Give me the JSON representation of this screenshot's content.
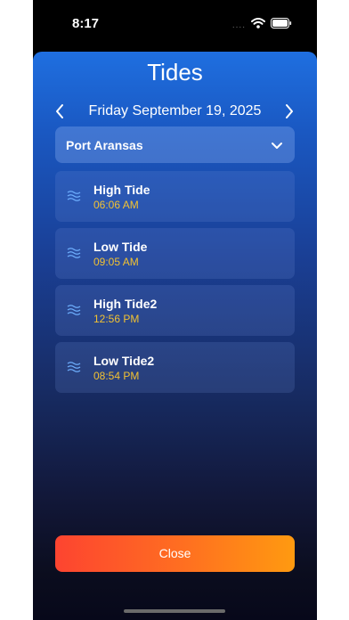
{
  "status_bar": {
    "time": "8:17",
    "dots": "...."
  },
  "header": {
    "title": "Tides"
  },
  "date_nav": {
    "date": "Friday September 19, 2025"
  },
  "location": {
    "selected": "Port Aransas"
  },
  "tides": [
    {
      "name": "High Tide",
      "time": "06:06 AM"
    },
    {
      "name": "Low Tide",
      "time": "09:05 AM"
    },
    {
      "name": "High Tide2",
      "time": "12:56 PM"
    },
    {
      "name": "Low Tide2",
      "time": "08:54 PM"
    }
  ],
  "actions": {
    "close_label": "Close"
  },
  "colors": {
    "accent_time": "#f2c232",
    "button_start": "#fd4430",
    "button_end": "#ff9a10"
  }
}
